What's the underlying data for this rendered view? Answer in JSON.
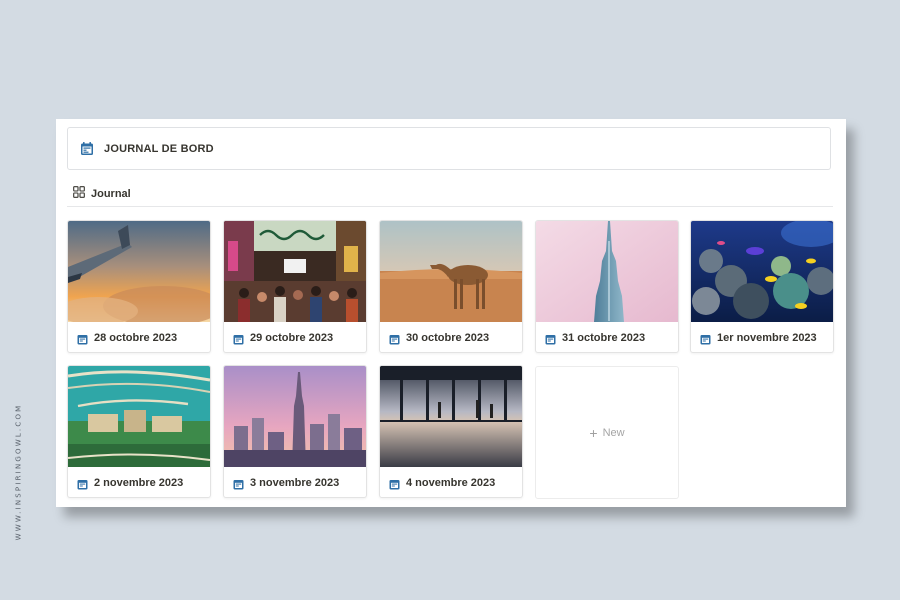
{
  "watermark": "WWW.INSPIRINGOWL.COM",
  "header": {
    "title": "JOURNAL DE BORD",
    "icon": "calendar-icon",
    "accent": "#2f6fa6"
  },
  "view": {
    "label": "Journal",
    "icon": "gallery-icon"
  },
  "cards": [
    {
      "title": "28 octobre 2023",
      "image": "airplane wing above clouds at sunset"
    },
    {
      "title": "29 octobre 2023",
      "image": "crowded souk market street"
    },
    {
      "title": "30 octobre 2023",
      "image": "camel walking in desert"
    },
    {
      "title": "31 octobre 2023",
      "image": "Burj Khalifa tower against pink sky"
    },
    {
      "title": "1er novembre 2023",
      "image": "aquarium with coral reef and fish"
    },
    {
      "title": "2 novembre 2023",
      "image": "aerial view of palm island resort"
    },
    {
      "title": "3 novembre 2023",
      "image": "city skyline at dusk"
    },
    {
      "title": "4 novembre 2023",
      "image": "airport terminal window silhouettes"
    }
  ],
  "new_card": {
    "label": "New",
    "icon": "plus-icon"
  }
}
